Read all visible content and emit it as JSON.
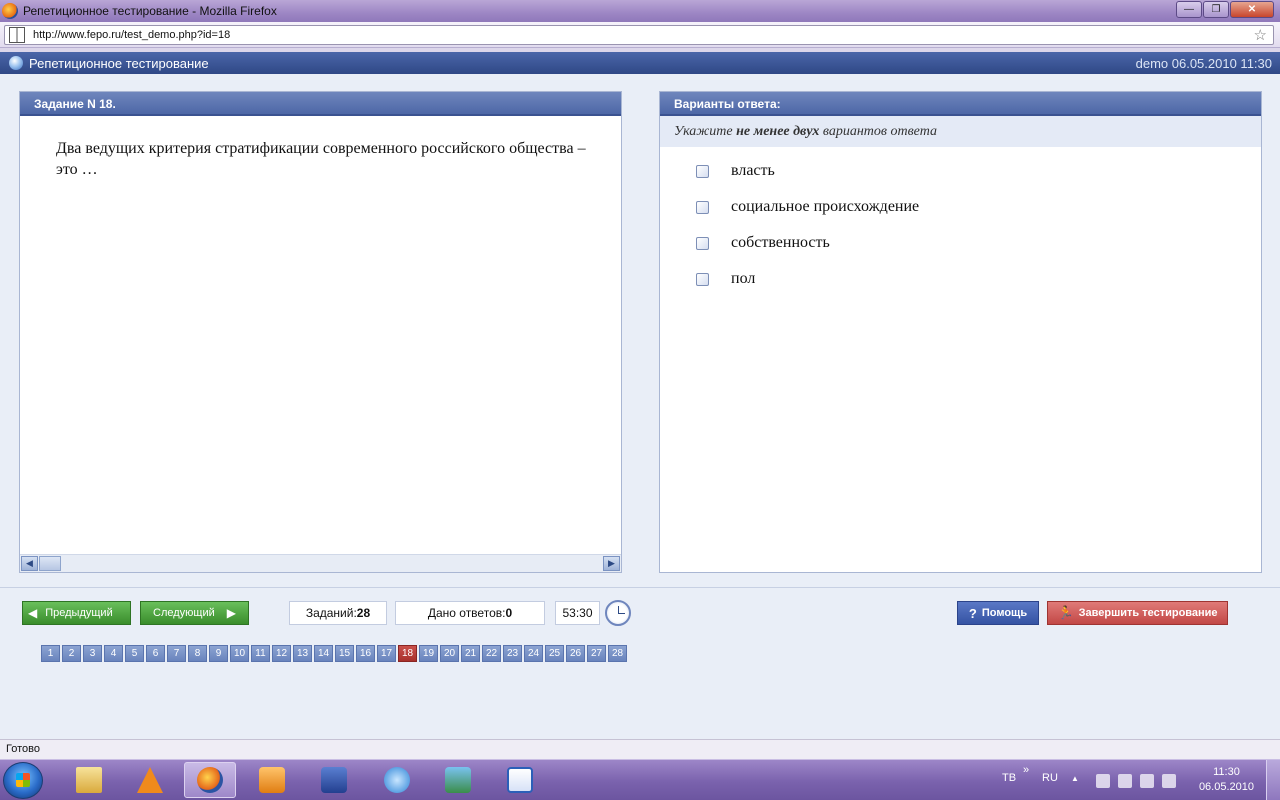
{
  "window": {
    "title": "Репетиционное тестирование - Mozilla Firefox",
    "btn_min": "—",
    "btn_max": "❐",
    "btn_close": "✕"
  },
  "address": {
    "url": "http://www.fepo.ru/test_demo.php?id=18",
    "bookmark_glyph": "☆"
  },
  "app": {
    "title": "Репетиционное тестирование",
    "meta": "demo 06.05.2010 11:30"
  },
  "task": {
    "header": "Задание N 18.",
    "text": "Два ведущих критерия стратификации современного российского общества – это …",
    "scroll_left": "◀",
    "scroll_right": "▶"
  },
  "answers": {
    "header": "Варианты ответа:",
    "hint_prefix": "Укажите ",
    "hint_bold": "не менее двух",
    "hint_suffix": " вариантов ответа",
    "options": [
      {
        "label": "власть",
        "checked": false
      },
      {
        "label": "социальное происхождение",
        "checked": false
      },
      {
        "label": "собственность",
        "checked": false
      },
      {
        "label": "пол",
        "checked": false
      }
    ]
  },
  "controls": {
    "prev_label": "Предыдущий",
    "next_label": "Следующий",
    "prev_arrow": "◀",
    "next_arrow": "▶",
    "tasks_label": "Заданий: ",
    "tasks_value": "28",
    "answered_label": "Дано ответов:",
    "answered_value": "0",
    "timer": "53:30",
    "help_label": "Помощь",
    "help_glyph": "?",
    "finish_label": "Завершить тестирование",
    "finish_glyph": "🏃"
  },
  "pager": {
    "current": 18,
    "pages": [
      "1",
      "2",
      "3",
      "4",
      "5",
      "6",
      "7",
      "8",
      "9",
      "10",
      "11",
      "12",
      "13",
      "14",
      "15",
      "16",
      "17",
      "18",
      "19",
      "20",
      "21",
      "22",
      "23",
      "24",
      "25",
      "26",
      "27",
      "28"
    ]
  },
  "status": {
    "text": "Готово"
  },
  "taskbar": {
    "apps": [
      "folder-icon",
      "vlc-icon",
      "firefox-icon",
      "media-player-icon",
      "floppy-icon",
      "itunes-icon",
      "photo-viewer-icon",
      "word-icon"
    ],
    "active_app": "firefox-icon",
    "lang_tb": "TB",
    "lang_ru": "RU",
    "expand": "»",
    "tray_up": "▲",
    "time": "11:30",
    "date": "06.05.2010"
  },
  "colors": {
    "header_blue": "#2f4886",
    "panel_head": "#5670ad",
    "nav_green": "#3a8d2c",
    "help_blue": "#3553a3",
    "finish_red": "#c24846",
    "current_page": "#a8302c"
  }
}
